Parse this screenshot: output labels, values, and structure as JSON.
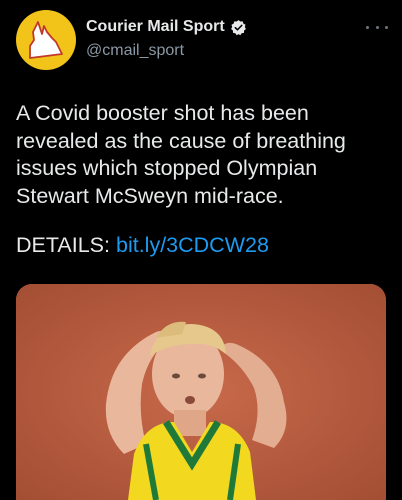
{
  "account": {
    "display_name": "Courier Mail Sport",
    "handle": "@cmail_sport",
    "verified": true,
    "avatar_icon": "queensland-map-logo"
  },
  "tweet": {
    "text": "A Covid booster shot has been revealed as the cause of breathing issues which stopped Olympian Stewart McSweyn mid-race.",
    "details_label": "DETAILS:",
    "link_text": "bit.ly/3CDCW28"
  },
  "icons": {
    "more": "more-options-icon",
    "verified": "verified-badge-icon"
  },
  "colors": {
    "background": "#000000",
    "link": "#1d9bf0",
    "avatar_bg": "#f2c419",
    "secondary_text": "#8b98a5"
  }
}
